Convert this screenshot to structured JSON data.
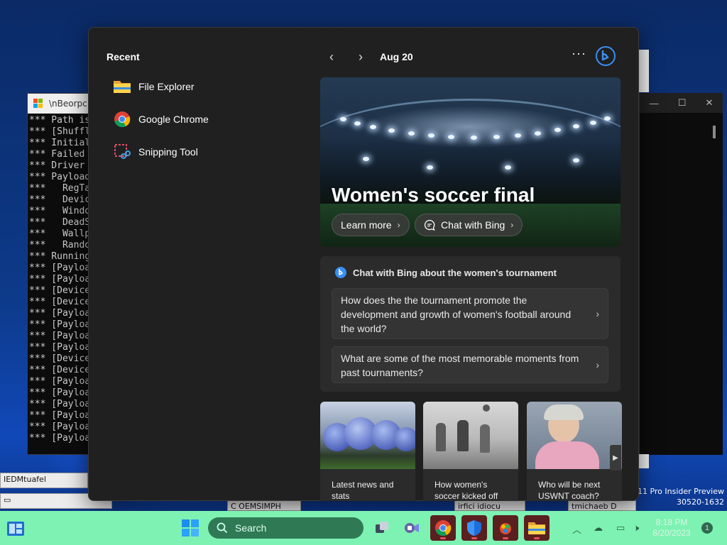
{
  "console": {
    "title": "\\nBeorpc.s",
    "lines": [
      "*** Path is",
      "*** [Shuffl",
      "*** Initial",
      "*** Failed ",
      "*** Driver ",
      "*** Payload",
      "***   RegTa",
      "***   Devic",
      "***   Windo",
      "***   DeadS",
      "***   Wallp",
      "***   Rando",
      "*** Running",
      "*** [Payloa",
      "*** [Payloa",
      "*** [Device",
      "*** [Device",
      "*** [Payloa",
      "*** [Payloa",
      "*** [Payloa",
      "*** [Payloa",
      "*** [Device",
      "*** [Device",
      "*** [Payloa",
      "*** [Payloa",
      "*** [Payloa",
      "*** [Payloa",
      "*** [Payloa",
      "*** [Payloa"
    ]
  },
  "background": {
    "mini_window_1": "IEDMtuafel",
    "mini_window_2": "C OEMSIMPH",
    "mini_window_3": "irfici idiocu",
    "mini_window_4": "tmichaeb D",
    "build_line1": "11 Pro Insider Preview",
    "build_line2": "30520-1632"
  },
  "widgets": {
    "recent_title": "Recent",
    "recent_items": [
      {
        "label": "File Explorer",
        "icon": "folder-icon"
      },
      {
        "label": "Google Chrome",
        "icon": "chrome-icon"
      },
      {
        "label": "Snipping Tool",
        "icon": "snipping-tool-icon"
      }
    ],
    "date": "Aug 20",
    "more": "···",
    "hero": {
      "title": "Women's soccer final",
      "learn_more": "Learn more",
      "chat_with_bing": "Chat with Bing"
    },
    "chat_card": {
      "heading": "Chat with Bing about the women's tournament",
      "questions": [
        "How does the the tournament promote the development and growth of women's football around the world?",
        "What are some of the most memorable moments from past tournaments?"
      ]
    },
    "news": [
      {
        "caption": "Latest news and stats"
      },
      {
        "caption": "How women's soccer kicked off"
      },
      {
        "caption": "Who will be next USWNT coach?"
      }
    ]
  },
  "taskbar": {
    "search_placeholder": "Search",
    "clock_time": "8:18 PM",
    "clock_date": "8/20/2023",
    "notification_count": "1",
    "colors": {
      "taskbar": "#7ef2b2",
      "search": "#2f7a55"
    }
  }
}
